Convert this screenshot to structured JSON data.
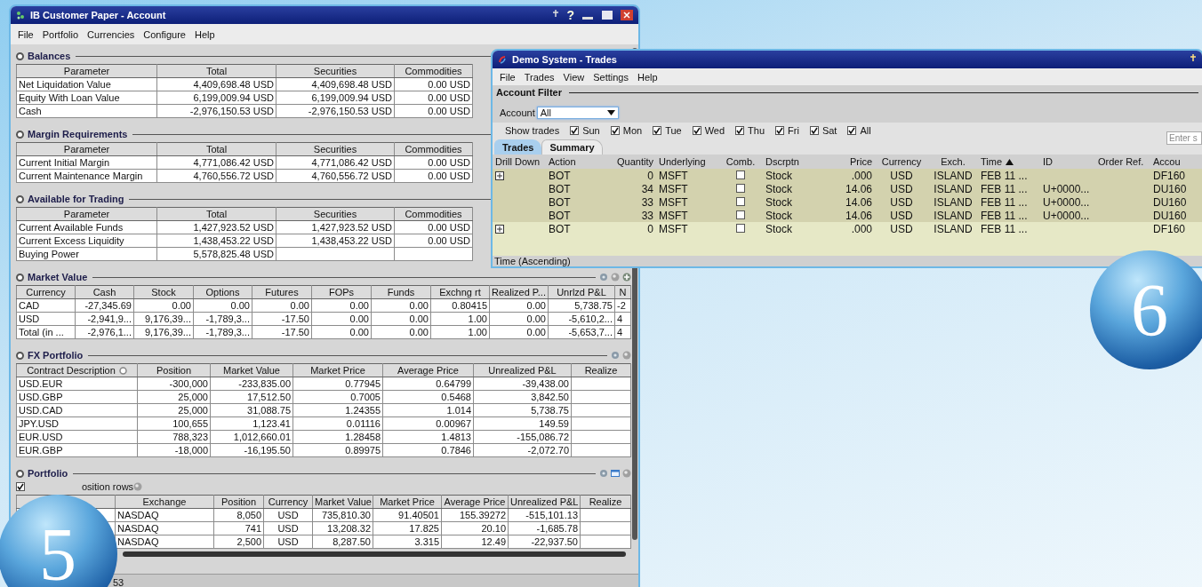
{
  "account_window": {
    "title": "IB Customer Paper - Account",
    "help_mark": "?",
    "menu": [
      "File",
      "Portfolio",
      "Currencies",
      "Configure",
      "Help"
    ],
    "sections": [
      {
        "title": "Balances",
        "columns": [
          {
            "label": "Parameter"
          },
          {
            "label": "Total"
          },
          {
            "label": "Securities"
          },
          {
            "label": "Commodities"
          }
        ],
        "rows": [
          [
            "Net Liquidation Value",
            "4,409,698.48 USD",
            "4,409,698.48 USD",
            "0.00 USD"
          ],
          [
            "Equity With Loan Value",
            "6,199,009.94 USD",
            "6,199,009.94 USD",
            "0.00 USD"
          ],
          [
            "Cash",
            "-2,976,150.53 USD",
            "-2,976,150.53 USD",
            "0.00 USD"
          ]
        ]
      },
      {
        "title": "Margin Requirements",
        "columns": [
          {
            "label": "Parameter"
          },
          {
            "label": "Total"
          },
          {
            "label": "Securities"
          },
          {
            "label": "Commodities"
          }
        ],
        "rows": [
          [
            "Current Initial Margin",
            "4,771,086.42 USD",
            "4,771,086.42 USD",
            "0.00 USD"
          ],
          [
            "Current Maintenance Margin",
            "4,760,556.72 USD",
            "4,760,556.72 USD",
            "0.00 USD"
          ]
        ]
      },
      {
        "title": "Available for Trading",
        "columns": [
          {
            "label": "Parameter"
          },
          {
            "label": "Total"
          },
          {
            "label": "Securities"
          },
          {
            "label": "Commodities"
          }
        ],
        "rows": [
          [
            "Current Available Funds",
            "1,427,923.52 USD",
            "1,427,923.52 USD",
            "0.00 USD"
          ],
          [
            "Current Excess Liquidity",
            "1,438,453.22 USD",
            "1,438,453.22 USD",
            "0.00 USD"
          ],
          [
            "Buying Power",
            "5,578,825.48 USD",
            null,
            null
          ]
        ]
      },
      {
        "title": "Market Value",
        "columns": [
          {
            "label": "Currency"
          },
          {
            "label": "Cash"
          },
          {
            "label": "Stock"
          },
          {
            "label": "Options"
          },
          {
            "label": "Futures"
          },
          {
            "label": "FOPs"
          },
          {
            "label": "Funds"
          },
          {
            "label": "Exchng rt"
          },
          {
            "label": "Realized P..."
          },
          {
            "label": "Unrlzd P&L"
          },
          {
            "label": "N"
          }
        ],
        "rows": [
          [
            "CAD",
            "-27,345.69",
            "0.00",
            "0.00",
            "0.00",
            "0.00",
            "0.00",
            "0.80415",
            "0.00",
            "5,738.75",
            "-2"
          ],
          [
            "USD",
            "-2,941,9...",
            "9,176,39...",
            "-1,789,3...",
            "-17.50",
            "0.00",
            "0.00",
            "1.00",
            "0.00",
            "-5,610,2...",
            "4"
          ],
          [
            "Total (in ...",
            "-2,976,1...",
            "9,176,39...",
            "-1,789,3...",
            "-17.50",
            "0.00",
            "0.00",
            "1.00",
            "0.00",
            "-5,653,7...",
            "4"
          ]
        ]
      },
      {
        "title": "FX Portfolio",
        "columns": [
          {
            "label": "Contract Description",
            "menu_icon": true
          },
          {
            "label": "Position"
          },
          {
            "label": "Market Value"
          },
          {
            "label": "Market Price"
          },
          {
            "label": "Average Price"
          },
          {
            "label": "Unrealized P&L"
          },
          {
            "label": "Realize"
          }
        ],
        "rows": [
          [
            "USD.EUR",
            "-300,000",
            "-233,835.00",
            "0.77945",
            "0.64799",
            "-39,438.00",
            null
          ],
          [
            "USD.GBP",
            "25,000",
            "17,512.50",
            "0.7005",
            "0.5468",
            "3,842.50",
            null
          ],
          [
            "USD.CAD",
            "25,000",
            "31,088.75",
            "1.24355",
            "1.014",
            "5,738.75",
            null
          ],
          [
            "JPY.USD",
            "100,655",
            "1,123.41",
            "0.01116",
            "0.00967",
            "149.59",
            null
          ],
          [
            "EUR.USD",
            "788,323",
            "1,012,660.01",
            "1.28458",
            "1.4813",
            "-155,086.72",
            null
          ],
          [
            "EUR.GBP",
            "-18,000",
            "-16,195.50",
            "0.89975",
            "0.7846",
            "-2,072.70",
            null
          ]
        ]
      },
      {
        "title": "Portfolio",
        "position_rows": {
          "label": "osition rows",
          "checked": true
        },
        "columns": [
          {
            "label": "Exchange"
          },
          {
            "label": "Position"
          },
          {
            "label": "Currency"
          },
          {
            "label": "Market Value"
          },
          {
            "label": "Market Price"
          },
          {
            "label": "Average Price"
          },
          {
            "label": "Unrealized P&L"
          },
          {
            "label": "Realize"
          }
        ],
        "rows": [
          [
            "NASDAQ",
            "8,050",
            "USD",
            "735,810.30",
            "91.40501",
            "155.39272",
            "-515,101.13",
            null
          ],
          [
            "NASDAQ",
            "741",
            "USD",
            "13,208.32",
            "17.825",
            "20.10",
            "-1,685.78",
            null
          ],
          [
            "NASDAQ",
            "2,500",
            "USD",
            "8,287.50",
            "3.315",
            "12.49",
            "-22,937.50",
            null
          ]
        ]
      }
    ],
    "status": "53"
  },
  "trades_window": {
    "title": "Demo System - Trades",
    "menu": [
      "File",
      "Trades",
      "View",
      "Settings",
      "Help"
    ],
    "filter_title": "Account Filter",
    "account_label": "Account",
    "account_value": "All",
    "show_label": "Show trades",
    "days": [
      {
        "label": "Sun",
        "checked": true
      },
      {
        "label": "Mon",
        "checked": true
      },
      {
        "label": "Tue",
        "checked": true
      },
      {
        "label": "Wed",
        "checked": true
      },
      {
        "label": "Thu",
        "checked": true
      },
      {
        "label": "Fri",
        "checked": true
      },
      {
        "label": "Sat",
        "checked": true
      },
      {
        "label": "All",
        "checked": true
      }
    ],
    "search_placeholder": "Enter s",
    "tabs": [
      {
        "label": "Trades",
        "selected": true
      },
      {
        "label": "Summary",
        "selected": false
      }
    ],
    "columns": [
      {
        "label": "Drill Down",
        "kind": "expand"
      },
      {
        "label": "Action",
        "kind": "text"
      },
      {
        "label": "Quantity",
        "kind": "text"
      },
      {
        "label": "Underlying",
        "kind": "text"
      },
      {
        "label": "Comb.",
        "kind": "check"
      },
      {
        "label": "Dscrptn",
        "kind": "text"
      },
      {
        "label": "Price",
        "kind": "text"
      },
      {
        "label": "Currency",
        "kind": "text"
      },
      {
        "label": "Exch.",
        "kind": "text"
      },
      {
        "label": "Time",
        "kind": "text",
        "sorted": true
      },
      {
        "label": "ID",
        "kind": "text"
      },
      {
        "label": "Order Ref.",
        "kind": "text"
      },
      {
        "label": "Accou",
        "kind": "text"
      }
    ],
    "rows": [
      {
        "expandable": true,
        "comb": false,
        "color": "#d3d2ae",
        "cells": [
          "",
          "BOT",
          "0",
          "MSFT",
          "",
          "Stock",
          ".000",
          "USD",
          "ISLAND",
          "FEB 11 ...",
          "",
          "",
          "DF160"
        ]
      },
      {
        "expandable": false,
        "comb": false,
        "color": "#d3d2ae",
        "cells": [
          "",
          "BOT",
          "34",
          "MSFT",
          "",
          "Stock",
          "14.06",
          "USD",
          "ISLAND",
          "FEB 11 ...",
          "U+0000...",
          "",
          "DU160"
        ]
      },
      {
        "expandable": false,
        "comb": false,
        "color": "#d3d2ae",
        "cells": [
          "",
          "BOT",
          "33",
          "MSFT",
          "",
          "Stock",
          "14.06",
          "USD",
          "ISLAND",
          "FEB 11 ...",
          "U+0000...",
          "",
          "DU160"
        ]
      },
      {
        "expandable": false,
        "comb": false,
        "color": "#d3d2ae",
        "cells": [
          "",
          "BOT",
          "33",
          "MSFT",
          "",
          "Stock",
          "14.06",
          "USD",
          "ISLAND",
          "FEB 11 ...",
          "U+0000...",
          "",
          "DU160"
        ]
      },
      {
        "expandable": true,
        "comb": false,
        "color": "#e6e8c6",
        "cells": [
          "",
          "BOT",
          "0",
          "MSFT",
          "",
          "Stock",
          ".000",
          "USD",
          "ISLAND",
          "FEB 11 ...",
          "",
          "",
          "DF160"
        ]
      }
    ],
    "status": "Time (Ascending)"
  },
  "badges": [
    {
      "label": "5"
    },
    {
      "label": "6"
    }
  ]
}
